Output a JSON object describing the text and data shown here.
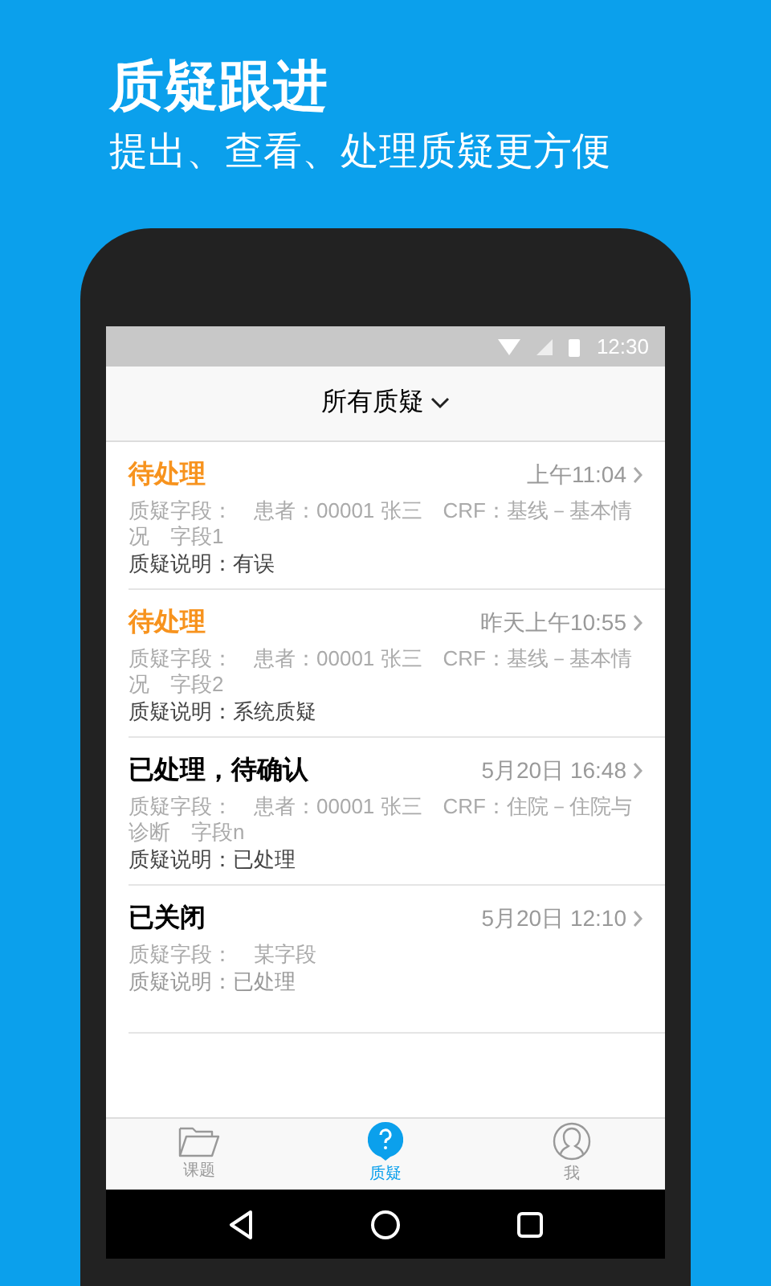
{
  "promo": {
    "title": "质疑跟进",
    "subtitle": "提出、查看、处理质疑更方便"
  },
  "status_bar": {
    "time": "12:30"
  },
  "header": {
    "title": "所有质疑"
  },
  "queries": [
    {
      "kind": "pending",
      "status": "待处理",
      "time": "上午11:04",
      "field": "质疑字段：　患者：00001 张三　CRF：基线－基本情况　字段1",
      "note": "质疑说明：有误"
    },
    {
      "kind": "pending",
      "status": "待处理",
      "time": "昨天上午10:55",
      "field": "质疑字段：　患者：00001 张三　CRF：基线－基本情况　字段2",
      "note": "质疑说明：系统质疑"
    },
    {
      "kind": "confirm",
      "status": "已处理，待确认",
      "time": "5月20日 16:48",
      "field": "质疑字段：　患者：00001 张三　CRF：住院－住院与诊断　字段n",
      "note": "质疑说明：已处理"
    },
    {
      "kind": "closed",
      "status": "已关闭",
      "time": "5月20日 12:10",
      "field": "质疑字段：　某字段",
      "note": "质疑说明：已处理"
    }
  ],
  "tabs": [
    {
      "label": "课题",
      "selected": false
    },
    {
      "label": "质疑",
      "selected": true
    },
    {
      "label": "我",
      "selected": false
    }
  ]
}
